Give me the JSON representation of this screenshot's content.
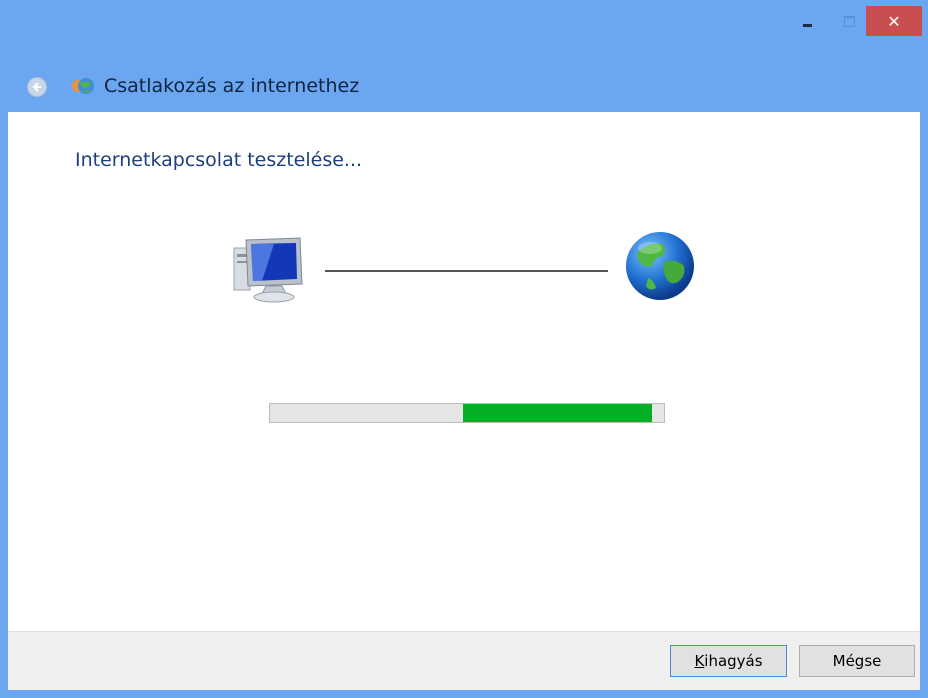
{
  "window": {
    "controls": {
      "minimize_icon": "minimize-icon",
      "maximize_icon": "maximize-icon",
      "close_glyph": "✕"
    }
  },
  "navbar": {
    "title": "Csatlakozás az internethez",
    "back_icon": "back-arrow-icon",
    "wizard_icon": "network-wizard-icon"
  },
  "main": {
    "heading": "Internetkapcsolat tesztelése...",
    "computer_icon": "computer-icon",
    "globe_icon": "globe-icon",
    "progress": {
      "start": 0.49,
      "end": 0.97,
      "style": "marquee"
    }
  },
  "footer": {
    "skip_button_first": "K",
    "skip_button_rest": "ihagyás",
    "cancel_button": "Mégse"
  },
  "colors": {
    "titlebar": "#6ba7f0",
    "close": "#c94e50",
    "heading": "#1e3f7c",
    "progress_fill": "#06b025"
  }
}
